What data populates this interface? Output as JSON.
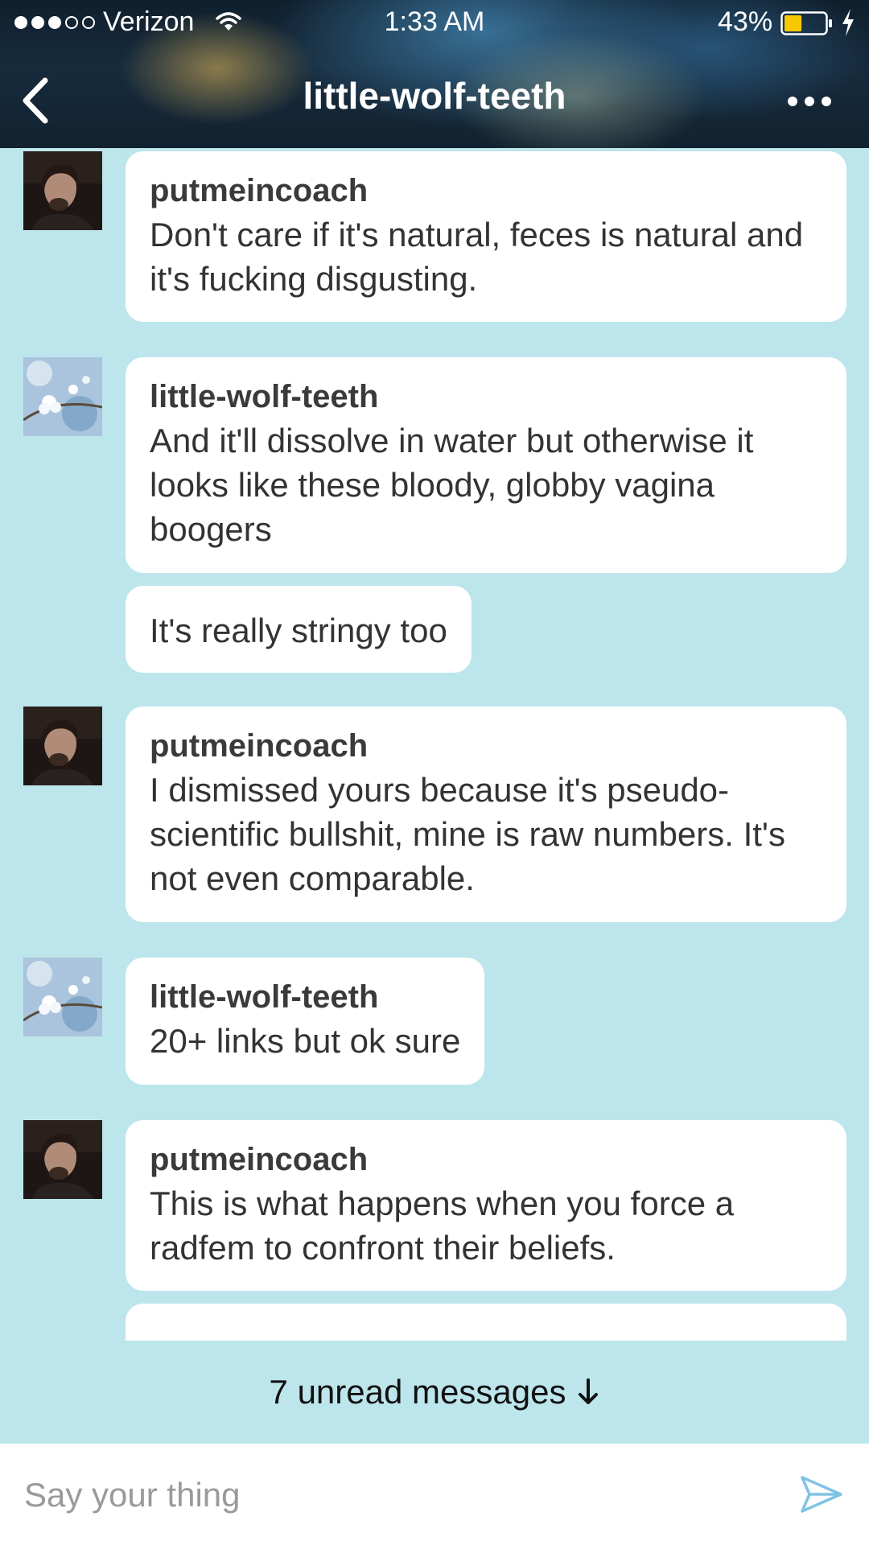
{
  "status_bar": {
    "carrier": "Verizon",
    "time": "1:33 AM",
    "battery": "43%",
    "battery_level": 0.43
  },
  "header": {
    "title": "little-wolf-teeth"
  },
  "colors": {
    "background": "#bde6ec",
    "bubble": "#ffffff",
    "battery_fill": "#f5c800"
  },
  "messages": [
    {
      "sender": "putmeincoach",
      "avatar": "man-portrait-avatar",
      "text": "Don't care if it's natural, feces is natural and it's fucking disgusting."
    },
    {
      "sender": "little-wolf-teeth",
      "avatar": "blossom-avatar",
      "text": "And it'll dissolve in water but otherwise it looks like these bloody, globby vagina boogers"
    },
    {
      "sender": "",
      "text": "It's really stringy too"
    },
    {
      "sender": "putmeincoach",
      "avatar": "man-portrait-avatar",
      "text": "I dismissed yours because it's pseudo-scientific bullshit, mine is raw numbers. It's not even comparable."
    },
    {
      "sender": "little-wolf-teeth",
      "avatar": "blossom-avatar",
      "text": "20+ links but ok sure"
    },
    {
      "sender": "putmeincoach",
      "avatar": "man-portrait-avatar",
      "text": "This is what happens when you force a radfem to confront their beliefs."
    }
  ],
  "unread": {
    "label": "7 unread messages"
  },
  "composer": {
    "placeholder": "Say your thing"
  }
}
